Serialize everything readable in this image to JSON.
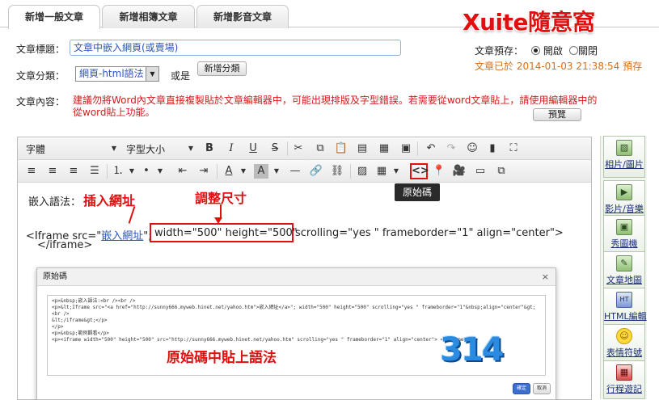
{
  "tabs": [
    "新增一般文章",
    "新增相簿文章",
    "新增影音文章"
  ],
  "brand": "Xuite隨意窩",
  "form": {
    "title_label": "文章標題：",
    "title_value": "文章中嵌入網頁(或賣場)",
    "category_label": "文章分類：",
    "category_value": "網頁-html語法",
    "or_label": "或是",
    "new_category_button": "新增分類",
    "preview_label": "文章預存：",
    "preview_on": "開啟",
    "preview_off": "關閉",
    "saved_status": "文章已於 2014-01-03 21:38:54 預存",
    "content_label": "文章內容：",
    "warning": "建議勿將Word內文章直接複製貼於文章編輯器中，可能出現排版及字型錯誤。若需要從word文章貼上，請使用編輯器中的從word貼上功能。",
    "preview_button": "預覽"
  },
  "toolbar": {
    "font_label": "字體",
    "size_label": "字型大小",
    "source_tooltip": "原始碼"
  },
  "editor": {
    "embed_label": "嵌入語法：",
    "annotation_insert_url": "插入網址",
    "annotation_resize": "調整尺寸",
    "code_line_start": "<Iframe src=\"",
    "code_link": "嵌入網址",
    "code_line_mid": "\";",
    "code_size": "width=\"500\" height=\"500\"",
    "code_line_end": "scrolling=\"yes \" frameborder=\"1\"  align=\"center\">",
    "code_close": "</iframe>"
  },
  "dialog": {
    "title": "原始碼",
    "code_lines": [
      "<p>&nbsp;嵌入語法:<br /><br />",
      "<p>&lt;Iframe src=\"<a href=\"http://sunny666.myweb.hinet.net/yahoo.htm\">嵌入網址</a>\"; width=\"500\" height=\"500\" scrolling=\"yes \" frameborder=\"1\"&nbsp;align=\"center\"&gt;<br />",
      "&lt;/iframe&gt;</p>",
      "</p>",
      "<p>&nbsp;範例觀看</p>",
      "<p><iframe width=\"500\" height=\"500\" src=\"http://sunny666.myweb.hinet.net/yahoo.htm\" scrolling=\"yes \" frameborder=\"1\" align=\"center\"> </iframe></p>"
    ],
    "annotation": "原始碼中貼上語法",
    "badge": "314",
    "ok_button": "確定",
    "cancel_button": "取消"
  },
  "right_panel": [
    {
      "label": "相片/圖片",
      "icon": "photo-icon"
    },
    {
      "label": "影片/音樂",
      "icon": "video-icon"
    },
    {
      "label": "秀圖機",
      "icon": "slideshow-icon"
    },
    {
      "label": "文章地圖",
      "icon": "map-icon"
    },
    {
      "label": "HTML編輯",
      "icon": "html-icon"
    },
    {
      "label": "表情符號",
      "icon": "smiley-icon"
    },
    {
      "label": "行程遊記",
      "icon": "calendar-icon"
    }
  ]
}
